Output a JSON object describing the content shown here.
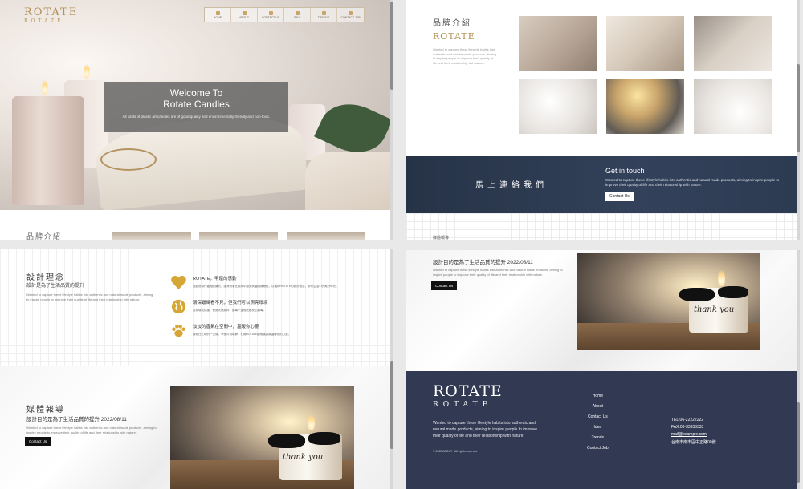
{
  "hero": {
    "logo": "ROTATE",
    "logo_sub": "ROTATE",
    "nav": [
      "HOME",
      "ABOUT",
      "CONTACT US",
      "IDEA",
      "TRENDS",
      "CONTACT JOB"
    ],
    "welcome_line1": "Welcome To",
    "welcome_line2": "Rotate Candles",
    "welcome_desc": "All kinds of plastic art candles are of good quality and environmentally friendly and non-toxic.",
    "brand_strip_title": "品牌介紹"
  },
  "brand": {
    "title": "品牌介紹",
    "logo": "ROTATE",
    "desc": "Wanted to capture these lifestyle habits into authentic and natural made products, aiming to inspire people to improve their quality of life and their relationship with nature."
  },
  "contact": {
    "title_cn": "馬上連絡我們",
    "title_en": "Get in touch",
    "desc": "Wanted to capture these lifestyle habits into authentic and natural made products, aiming to inspire people to improve their quality of life and their relationship with nature.",
    "button": "Contact Us",
    "cut_label": "媒體報導"
  },
  "design": {
    "title": "設計理念",
    "subtitle": "設計是為了生活品質的提升",
    "desc": "Wanted to capture these lifestyle habits into authentic and natural made products, aiming to inspire people to improve their quality of life and their relationship with nature.",
    "features": [
      {
        "icon": "heart-icon",
        "title": "ROTATE，甲還的感動",
        "desc": "透過對製作蠟燭的講究，讓消費者在使用中感受到溫暖與療癒，以植物ROTATE的設計理念，帶來生活中的美好時光。"
      },
      {
        "icon": "globe-icon",
        "title": "環保蠟燭看不見，但我們可以照亮環境",
        "desc": "重視環境保護，使用天然原料，讓每一盞燭光都安心無毒。"
      },
      {
        "icon": "paw-icon",
        "title": "淡淡的香氣在空間中，溫暖你心靈",
        "desc": "讓你在忙碌的一天後，享受片刻寧靜，打開ROTATE蠟燭讓香氣溫暖你的心靈。"
      }
    ]
  },
  "media": {
    "title": "媒體報導",
    "subtitle": "設計目的是為了生活品質的提升 2022/08/11",
    "desc": "Wanted to capture these lifestyle habits into authentic and natural made products, aiming to inspire people to improve their quality of life and their relationship with nature.",
    "button": "Contact Us",
    "photo_text": "thank you"
  },
  "footer": {
    "logo": "ROTATE",
    "logo_sub": "ROTATE",
    "desc": "Wanted to capture these lifestyle habits into authentic and natural made products, aiming to inspire people to improve their quality of life and their relationship with nature.",
    "copyright": "© 2022 ABOUT · All rights reserved",
    "nav": [
      "Home",
      "About",
      "Contact Us",
      "Idea",
      "Trends",
      "Contact Job"
    ],
    "tel": "TEL:06-22222222",
    "fax": "FAX:06-33333333",
    "mail": "mail@example.com",
    "address": "台南市南市區中正路00號"
  },
  "colors": {
    "gold": "#b39057",
    "navy": "#313a52",
    "contact_bg": "#2c3a52"
  }
}
